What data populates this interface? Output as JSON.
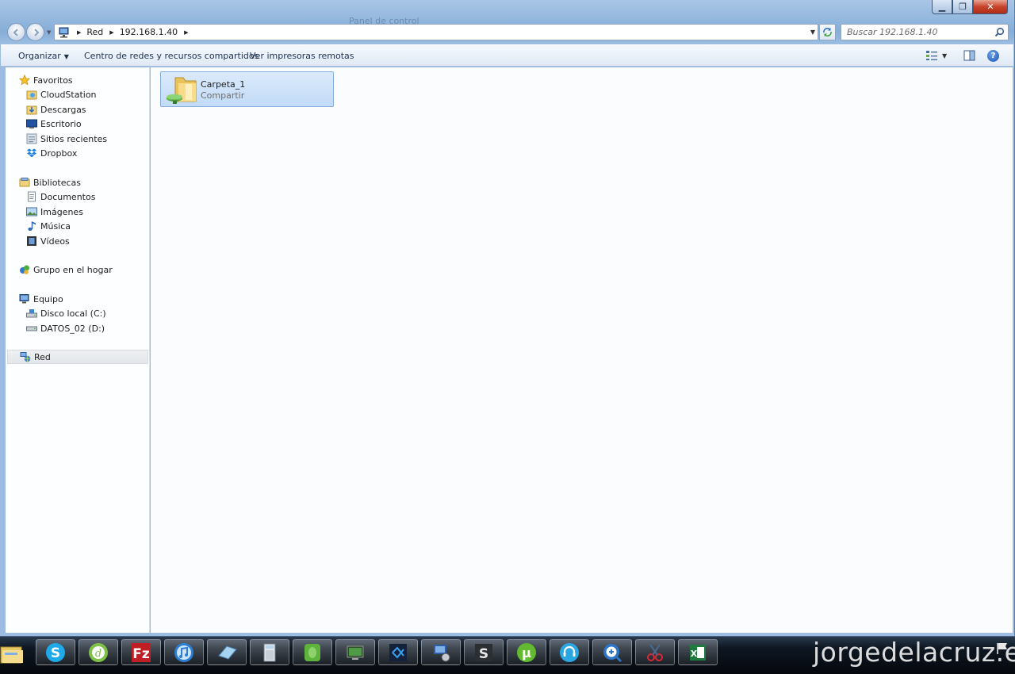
{
  "window": {
    "title": "Panel de control",
    "buttons": {
      "minimize": "▁",
      "maximize": "❐",
      "close": "✕"
    }
  },
  "address": {
    "crumbs": [
      "Red",
      "192.168.1.40"
    ]
  },
  "search": {
    "placeholder": "Buscar 192.168.1.40"
  },
  "toolbar": {
    "organize": "Organizar",
    "network_center": "Centro de redes y recursos compartidos",
    "remote_printers": "Ver impresoras remotas",
    "help": "?"
  },
  "sidebar": {
    "favorites": {
      "label": "Favoritos",
      "items": [
        "CloudStation",
        "Descargas",
        "Escritorio",
        "Sitios recientes",
        "Dropbox"
      ]
    },
    "libraries": {
      "label": "Bibliotecas",
      "items": [
        "Documentos",
        "Imágenes",
        "Música",
        "Vídeos"
      ]
    },
    "homegroup": {
      "label": "Grupo en el hogar"
    },
    "computer": {
      "label": "Equipo",
      "items": [
        "Disco local (C:)",
        "DATOS_02 (D:)"
      ]
    },
    "network": {
      "label": "Red"
    }
  },
  "content": {
    "items": [
      {
        "name": "Carpeta_1",
        "subtitle": "Compartir"
      }
    ]
  },
  "taskbar": {
    "apps": [
      "skype-icon",
      "dreamweaver-icon",
      "filezilla-icon",
      "itunes-icon",
      "notepad-icon",
      "calculator-icon",
      "evernote-icon",
      "remote-desktop-icon",
      "vs-icon",
      "network-monitor-icon",
      "sublime-icon",
      "utorrent-icon",
      "headset-icon",
      "zoom-icon",
      "snipping-tool-icon",
      "excel-icon"
    ],
    "watermark": "jorgedelacruz.es"
  },
  "colors": {
    "accent": "#1a53b3",
    "selection": "#c2dbf7"
  }
}
